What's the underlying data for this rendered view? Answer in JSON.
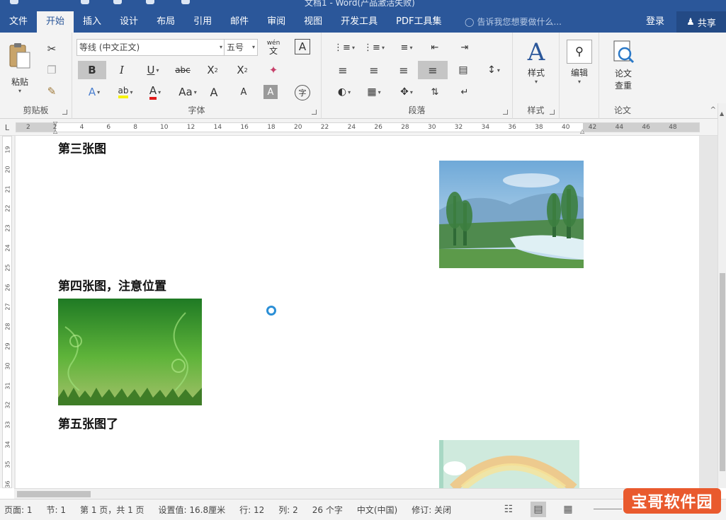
{
  "window": {
    "title": "文档1 - Word(产品激活失败)"
  },
  "tabs": [
    "文件",
    "开始",
    "插入",
    "设计",
    "布局",
    "引用",
    "邮件",
    "审阅",
    "视图",
    "开发工具",
    "PDF工具集"
  ],
  "tellme": {
    "text": "告诉我您想要做什么..."
  },
  "account": {
    "login": "登录",
    "share": "共享"
  },
  "ribbon": {
    "clipboard": {
      "label": "剪贴板",
      "paste": "粘贴"
    },
    "font": {
      "label": "字体",
      "family": "等线 (中文正文)",
      "size": "五号",
      "phonetic_top": "wén",
      "phonetic_bottom": "文",
      "charborder": "A",
      "bold": "B",
      "italic": "I",
      "underline": "U",
      "strike": "abc",
      "sub": "X",
      "sub_small": "2",
      "sup": "X",
      "sup_small": "2",
      "effect": "A",
      "highlight": "ab",
      "fontcolor": "A",
      "case": "Aa",
      "grow": "A",
      "shrink": "A",
      "shade": "A",
      "enclose": "字"
    },
    "paragraph": {
      "label": "段落"
    },
    "styles": {
      "label": "样式",
      "btn": "样式"
    },
    "editing": {
      "btn": "编辑"
    },
    "paper": {
      "label": "论文",
      "btn1": "论文",
      "btn2": "查重"
    }
  },
  "ruler": {
    "corner": "L",
    "ticks": [
      "2",
      "2",
      "4",
      "6",
      "8",
      "10",
      "12",
      "14",
      "16",
      "18",
      "20",
      "22",
      "24",
      "26",
      "28",
      "30",
      "32",
      "34",
      "36",
      "38",
      "40",
      "42",
      "44",
      "46",
      "48"
    ]
  },
  "vruler": {
    "ticks": [
      "19",
      "20",
      "21",
      "22",
      "23",
      "24",
      "25",
      "26",
      "27",
      "28",
      "29",
      "30",
      "31",
      "32",
      "33",
      "34",
      "35",
      "36"
    ]
  },
  "document": {
    "heading3": "第三张图",
    "heading4": "第四张图，注意位置",
    "heading5": "第五张图了"
  },
  "status": {
    "page": "页面: 1",
    "section": "节: 1",
    "pages": "第 1 页，共 1 页",
    "position": "设置值: 16.8厘米",
    "line": "行: 12",
    "column": "列: 2",
    "words": "26 个字",
    "language": "中文(中国)",
    "revisions": "修订: 关闭"
  },
  "watermark": "宝哥软件园",
  "colors": {
    "brand": "#2b579a",
    "ribbon_bg": "#f3f3f3",
    "watermark": "#e95a2e"
  }
}
